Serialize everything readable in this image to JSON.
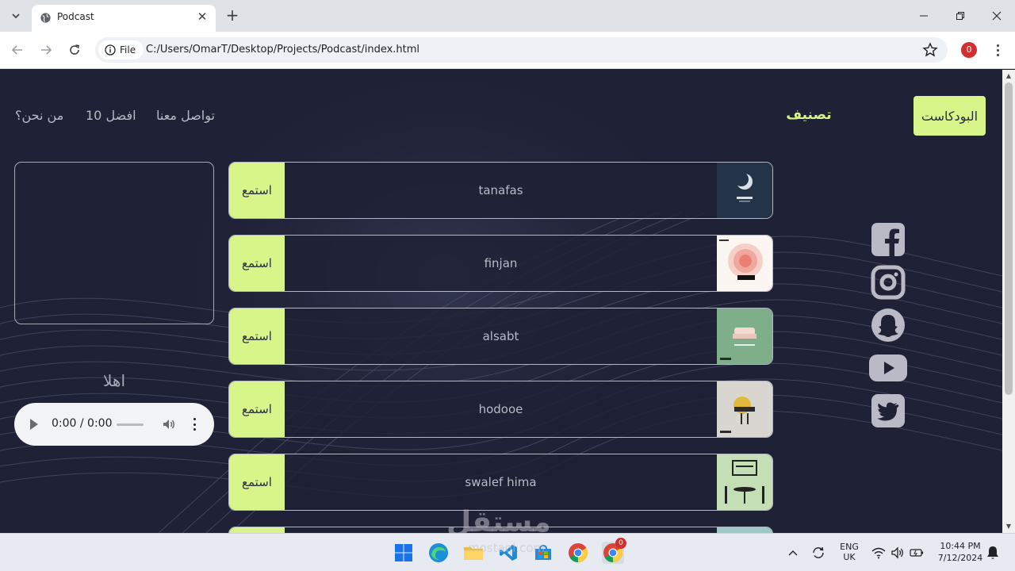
{
  "browser": {
    "tab_title": "Podcast",
    "site_chip_label": "File",
    "url": "C:/Users/OmarT/Desktop/Projects/Podcast/index.html",
    "profile_badge": "0"
  },
  "nav": {
    "brand": "البودكاست",
    "category": "تصنيف",
    "links": [
      "تواصل معنا",
      "افضل 10",
      "من نحن؟"
    ]
  },
  "player": {
    "greeting": "اهلا",
    "time": "0:00 / 0:00"
  },
  "podcasts": [
    {
      "name": "tanafas",
      "listen": "استمع",
      "cover": "cover-tanafas"
    },
    {
      "name": "finjan",
      "listen": "استمع",
      "cover": "cover-finjan"
    },
    {
      "name": "alsabt",
      "listen": "استمع",
      "cover": "cover-alsabt"
    },
    {
      "name": "hodooe",
      "listen": "استمع",
      "cover": "cover-hodooe"
    },
    {
      "name": "swalef hima",
      "listen": "استمع",
      "cover": "cover-swalef-hima"
    }
  ],
  "socials": [
    "facebook-icon",
    "instagram-icon",
    "snapchat-icon",
    "youtube-icon",
    "twitter-icon"
  ],
  "colors": {
    "page_bg": "#1f2136",
    "accent": "#d8f589",
    "muted_text": "#b9bac6"
  },
  "watermark": {
    "main": "مستقل",
    "sub": "mostaql.com"
  },
  "taskbar": {
    "lang_line1": "ENG",
    "lang_line2": "UK",
    "time": "10:44 PM",
    "date": "7/12/2024",
    "chrome_badge": "0"
  }
}
